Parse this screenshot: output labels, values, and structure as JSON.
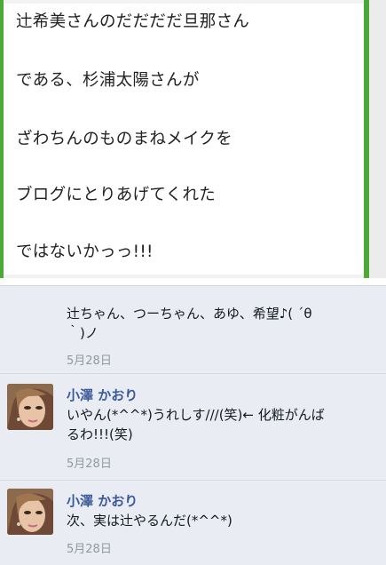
{
  "blog": {
    "lines": [
      "辻希美さんのだだだだ旦那さん",
      "である、杉浦太陽さんが",
      "ざわちんのものまねメイクを",
      "ブログにとりあげてくれた",
      "ではないかっっ!!!"
    ]
  },
  "comments": [
    {
      "text_lines": [
        "辻ちゃん、つーちゃん、あゆ、希望♪( ´θ",
        "｀)ノ"
      ],
      "date": "5月28日"
    },
    {
      "name": "小澤 かおり",
      "text_lines": [
        "いやん(*^^*)うれしす///(笑)← 化粧がんば",
        "るわ!!!(笑)"
      ],
      "date": "5月28日"
    },
    {
      "name": "小澤 かおり",
      "text_lines": [
        "次、実は辻やるんだ(*^^*)"
      ],
      "date": "5月28日"
    }
  ]
}
